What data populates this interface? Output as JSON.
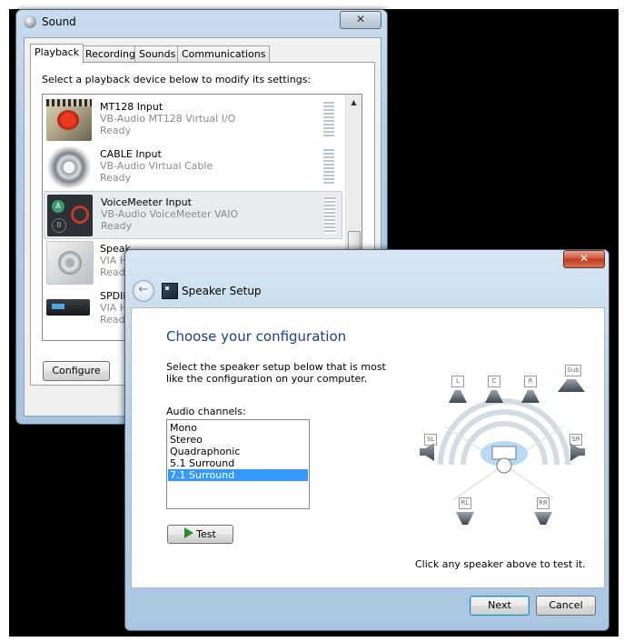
{
  "sound_window": {
    "title": "Sound",
    "close_label": "✕",
    "tabs": [
      {
        "label": "Playback",
        "active": true
      },
      {
        "label": "Recording",
        "active": false
      },
      {
        "label": "Sounds",
        "active": false
      },
      {
        "label": "Communications",
        "active": false
      }
    ],
    "instruction": "Select a playback device below to modify its settings:",
    "devices": [
      {
        "name": "MT128 Input",
        "desc": "VB-Audio MT128 Virtual I/O",
        "status": "Ready",
        "icon": "mixer-icon",
        "selected": false
      },
      {
        "name": "CABLE Input",
        "desc": "VB-Audio Virtual Cable",
        "status": "Ready",
        "icon": "cable-reel-icon",
        "selected": false
      },
      {
        "name": "VoiceMeeter Input",
        "desc": "VB-Audio VoiceMeeter VAIO",
        "status": "Ready",
        "icon": "voicemeeter-icon",
        "selected": true
      },
      {
        "name": "Speak",
        "desc": "VIA H",
        "status": "Read",
        "icon": "speaker-icon",
        "selected": false
      },
      {
        "name": "SPDIF",
        "desc": "VIA H",
        "status": "Read",
        "icon": "receiver-icon",
        "selected": false
      }
    ],
    "scroll_up": "▲",
    "configure_label": "Configure"
  },
  "wizard": {
    "title": "Speaker Setup",
    "close_label": "✕",
    "back_label": "←",
    "heading": "Choose your configuration",
    "instruction": "Select the speaker setup below that is most like the configuration on your computer.",
    "channels_label": "Audio channels:",
    "channels": [
      {
        "label": "Mono",
        "selected": false
      },
      {
        "label": "Stereo",
        "selected": false
      },
      {
        "label": "Quadraphonic",
        "selected": false
      },
      {
        "label": "5.1 Surround",
        "selected": false
      },
      {
        "label": "7.1 Surround",
        "selected": true
      }
    ],
    "test_label": "Test",
    "speakers": {
      "L": "L",
      "C": "C",
      "R": "R",
      "Sub": "Sub",
      "SL": "SL",
      "SR": "SR",
      "RL": "RL",
      "RR": "RR"
    },
    "hint": "Click any speaker above to test it.",
    "next_label": "Next",
    "cancel_label": "Cancel"
  }
}
